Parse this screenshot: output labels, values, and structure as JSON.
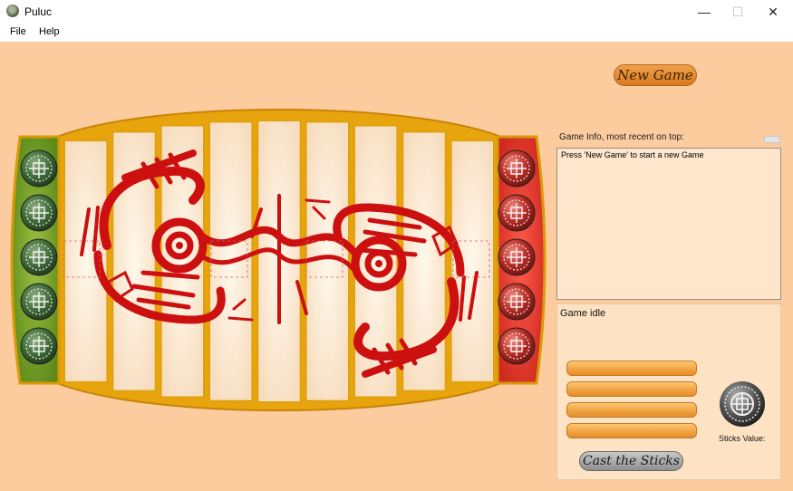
{
  "window": {
    "title": "Puluc",
    "minimize": "—",
    "maximize": "☐",
    "close": "✕"
  },
  "menu": {
    "file": "File",
    "help": "Help"
  },
  "controls": {
    "new_game": "New Game",
    "cast_sticks": "Cast the Sticks"
  },
  "info": {
    "label": "Game Info, most recent on top:",
    "messages": [
      "Press 'New Game' to start a new Game"
    ]
  },
  "status": {
    "text": "Game idle",
    "sticks_value_label": "Sticks Value:"
  },
  "sticks": {
    "count": 4
  },
  "board": {
    "lanes": 9,
    "green_team_pieces": 5,
    "red_team_pieces": 5
  },
  "colors": {
    "background": "#fccb9e",
    "board_frame": "#e8a40c",
    "green_home": "#79a22a",
    "red_home": "#e53a2f",
    "glyph_red": "#cc0f0f",
    "stick_orange": "#f0a13f"
  }
}
